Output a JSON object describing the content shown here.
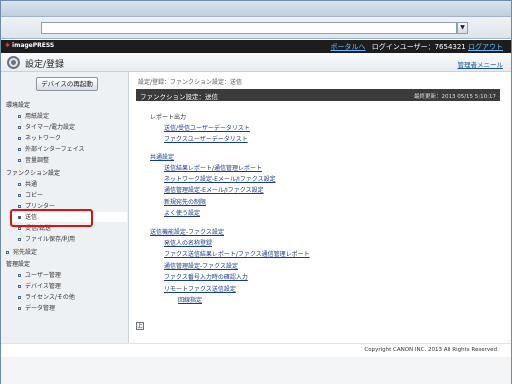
{
  "topbar": {
    "brand": "imagePRESS",
    "portal_link": "ポータルへ",
    "login_user": "ログインユーザー：7654321",
    "logout": "ログアウト"
  },
  "header": {
    "title": "設定/登録",
    "admin_link": "管理者メニール",
    "icon": "settings-gear-icon"
  },
  "sidebar": {
    "restart_button": "デバイスの再起動",
    "sections": [
      {
        "label": "環境設定",
        "items": [
          "用紙設定",
          "タイマー/電力設定",
          "ネットワーク",
          "外部インターフェイス",
          "音量調整"
        ]
      },
      {
        "label": "ファンクション設定",
        "items": [
          "共通",
          "コピー",
          "プリンター",
          "送信",
          "受信/転送",
          "ファイル保存/利用"
        ]
      },
      {
        "label": "宛先設定",
        "items": []
      },
      {
        "label": "管理設定",
        "items": [
          "ユーザー管理",
          "デバイス管理",
          "ライセンス/その他",
          "データ管理"
        ]
      }
    ],
    "active_item": "送信"
  },
  "main": {
    "breadcrumb": "設定/登録：ファンクション設定：送信",
    "title": "ファンクション設定：送信",
    "last_updated": "最終更新：2013 05/15 5:10:17",
    "groups": [
      {
        "label": "レポート出力",
        "links": [
          "送信/受信ユーザーデータリスト",
          "ファクスユーザーデータリスト"
        ]
      },
      {
        "label": "共通設定",
        "links": [
          "送信結果レポート/通信管理レポート",
          "ネットワーク設定-Eメール/Iファクス設定",
          "通信管理設定-Eメール/Iファクス設定",
          "新規宛先の制限",
          "よく使う設定"
        ]
      },
      {
        "label": "送信機能設定-ファクス設定",
        "links": [
          "発信人の名称登録",
          "ファクス送信結果レポート/ファクス通信管理レポート",
          "通信管理設定-ファクス設定",
          "ファクス番号入力時の確認入力",
          "リモートファクス送信設定",
          "回線指定"
        ]
      }
    ],
    "back_button": "上"
  },
  "footer": {
    "copyright": "Copyright CANON INC. 2013 All Rights Reserved"
  }
}
